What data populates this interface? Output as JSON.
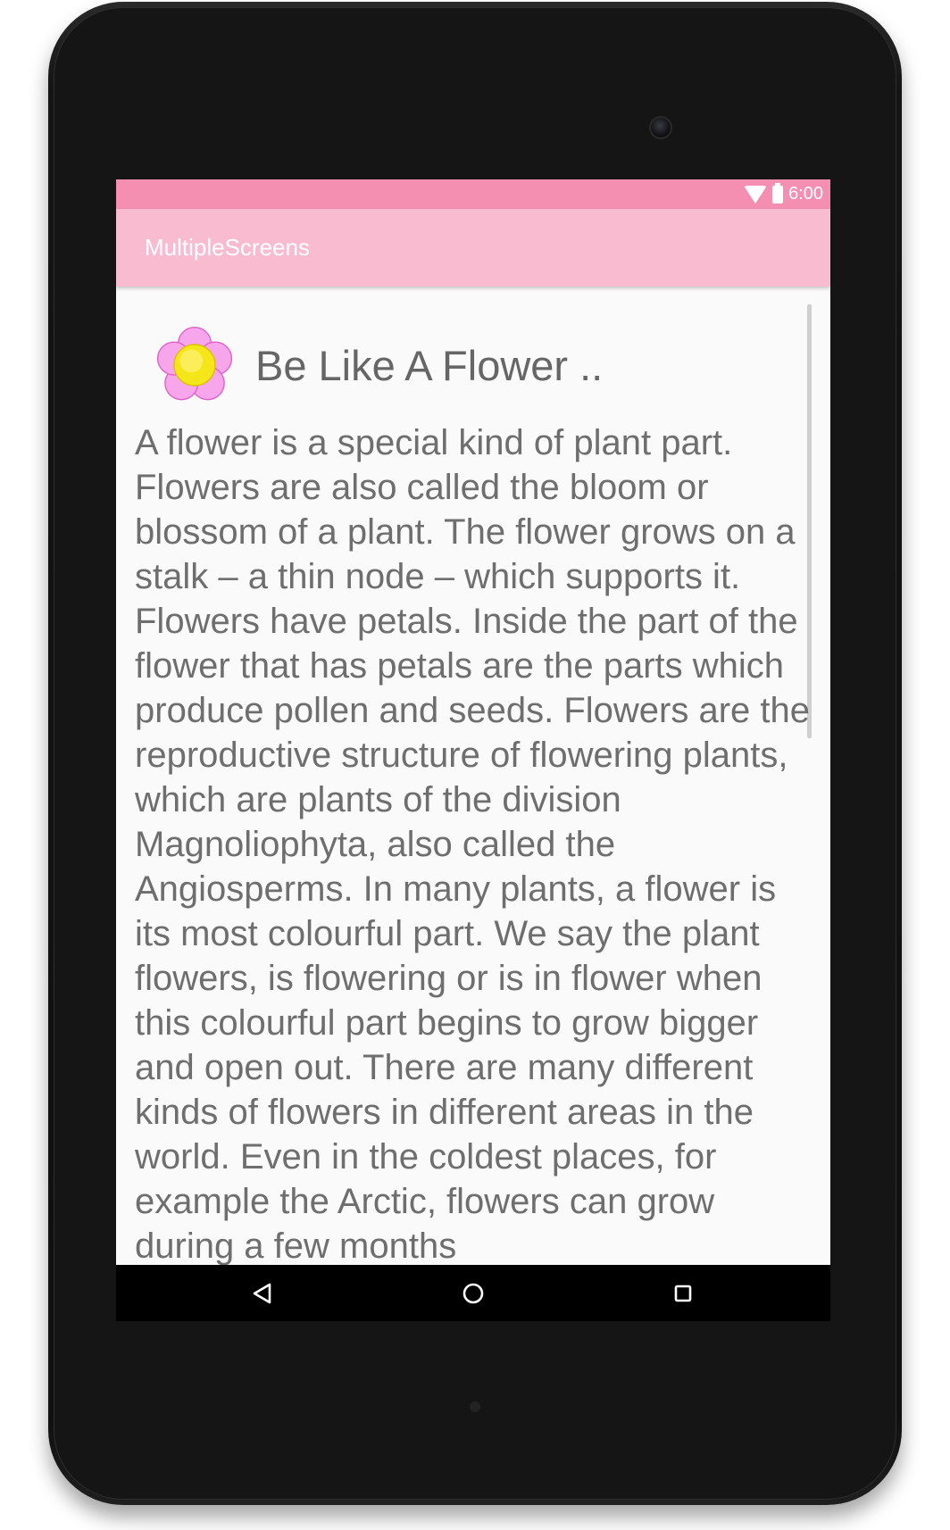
{
  "status_bar": {
    "time": "6:00",
    "icons": [
      "wifi-icon",
      "battery-icon"
    ]
  },
  "app_bar": {
    "title": "MultipleScreens"
  },
  "content": {
    "flower_icon": "flower-icon",
    "heading": "Be Like A Flower ..",
    "body": "A flower is a special kind of plant part. Flowers are also called the bloom or blossom of a plant. The flower grows on a stalk – a thin node – which supports it. Flowers have petals. Inside the part of the flower that has petals are the parts which produce pollen and seeds. Flowers are the reproductive structure of flowering plants, which are plants of the division Magnoliophyta, also called the Angiosperms. In many plants, a flower is its most colourful part. We say the plant flowers, is flowering or is in flower when this colourful part begins to grow bigger and open out. There are many different kinds of flowers in different areas in the world. Even in the coldest places, for example the Arctic, flowers can grow during a few months"
  },
  "nav_bar": {
    "buttons": [
      "back-icon",
      "home-icon",
      "recents-icon"
    ]
  },
  "colors": {
    "status_bar": "#f48fb1",
    "app_bar": "#f8bbd0",
    "background": "#fafafa",
    "text": "#6e6e6e",
    "nav_bar": "#000000"
  }
}
